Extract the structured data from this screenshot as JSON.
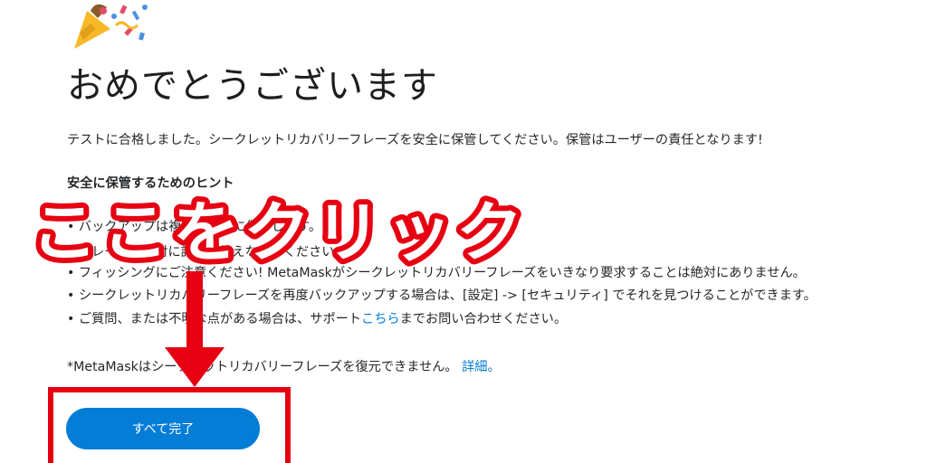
{
  "page": {
    "title": "おめでとうございます",
    "intro": "テストに合格しました。シークレットリカバリーフレーズを安全に保管してください。保管はユーザーの責任となります!",
    "hints_heading": "安全に保管するためのヒント",
    "hints": [
      "• バックアップは複数の場所に保存します。",
      "• フレーズは絶対に誰にも教えないでください。",
      "• フィッシングにご注意ください! MetaMaskがシークレットリカバリーフレーズをいきなり要求することは絶対にありません。",
      "• シークレットリカバリーフレーズを再度バックアップする場合は、[設定] -> [セキュリティ] でそれを見つけることができます。"
    ],
    "hint5_prefix": "• ご質問、または不明な点がある場合は、サポート",
    "hint5_link": "こちら",
    "hint5_suffix": "までお問い合わせください。",
    "note_text": "*MetaMaskはシークレットリカバリーフレーズを復元できません。",
    "note_link": "詳細。",
    "done_label": "すべて完了"
  },
  "annotation": {
    "callout_text": "ここをクリック",
    "color": "#e60012"
  },
  "colors": {
    "accent": "#037dd6",
    "annotation_red": "#e60012"
  },
  "icons": {
    "header_icon": "party-popper-icon",
    "arrow": "arrow-down-icon"
  }
}
